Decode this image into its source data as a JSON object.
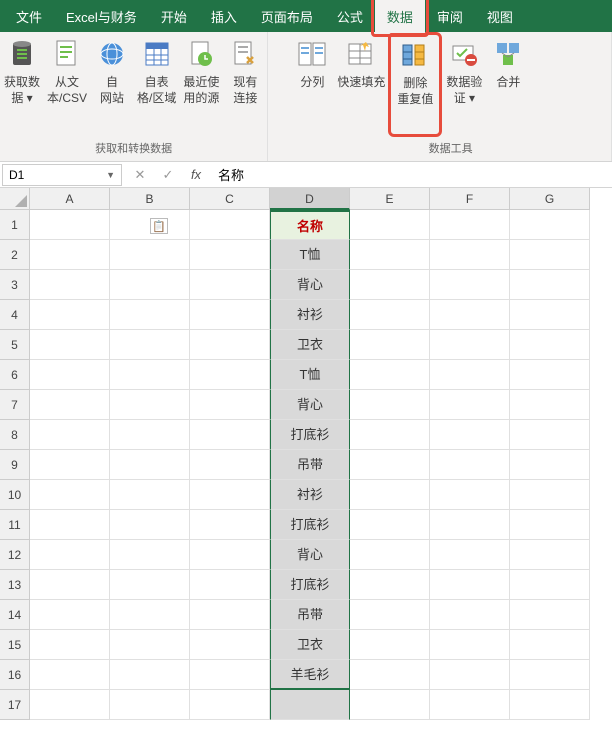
{
  "menu": {
    "items": [
      "文件",
      "Excel与财务",
      "开始",
      "插入",
      "页面布局",
      "公式",
      "数据",
      "审阅",
      "视图"
    ],
    "active_index": 6
  },
  "ribbon": {
    "group1": {
      "label": "获取和转换数据",
      "btns": [
        {
          "label": "获取数\n据 ▾"
        },
        {
          "label": "从文\n本/CSV"
        },
        {
          "label": "自\n网站"
        },
        {
          "label": "自表\n格/区域"
        },
        {
          "label": "最近使\n用的源"
        },
        {
          "label": "现有\n连接"
        }
      ]
    },
    "group2": {
      "label": "数据工具",
      "btns": [
        {
          "label": "分列"
        },
        {
          "label": "快速填充"
        },
        {
          "label": "删除\n重复值"
        },
        {
          "label": "数据验\n证 ▾"
        },
        {
          "label": "合并"
        }
      ]
    }
  },
  "formula_bar": {
    "name_box": "D1",
    "fx_value": "名称"
  },
  "grid": {
    "cols": [
      {
        "letter": "A",
        "w": 80
      },
      {
        "letter": "B",
        "w": 80
      },
      {
        "letter": "C",
        "w": 80
      },
      {
        "letter": "D",
        "w": 80
      },
      {
        "letter": "E",
        "w": 80
      },
      {
        "letter": "F",
        "w": 80
      },
      {
        "letter": "G",
        "w": 80
      }
    ],
    "rows": 17,
    "selected_col": "D",
    "d_values": [
      "名称",
      "T恤",
      "背心",
      "衬衫",
      "卫衣",
      "T恤",
      "背心",
      "打底衫",
      "吊带",
      "衬衫",
      "打底衫",
      "背心",
      "打底衫",
      "吊带",
      "卫衣",
      "羊毛衫",
      ""
    ]
  }
}
